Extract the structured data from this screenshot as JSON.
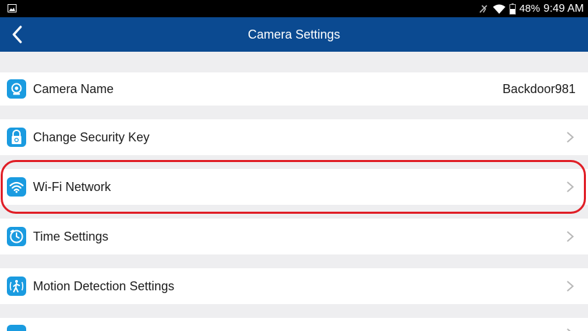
{
  "status_bar": {
    "battery": "48%",
    "time": "9:49 AM"
  },
  "header": {
    "title": "Camera Settings",
    "back_icon": "back-arrow-icon"
  },
  "settings": [
    {
      "label": "Camera Name",
      "value": "Backdoor981",
      "icon": "camera-icon",
      "chevron": false
    },
    {
      "label": "Change Security Key",
      "icon": "lock-icon",
      "chevron": true
    },
    {
      "label": "Wi-Fi Network",
      "icon": "wifi-icon",
      "chevron": true,
      "highlighted": true
    },
    {
      "label": "Time Settings",
      "icon": "clock-icon",
      "chevron": true
    },
    {
      "label": "Motion Detection Settings",
      "icon": "motion-icon",
      "chevron": true
    }
  ],
  "colors": {
    "app_bar": "#0b4a91",
    "icon_tile": "#1a9be0",
    "highlight": "#e01e26",
    "background": "#eeeef0"
  }
}
